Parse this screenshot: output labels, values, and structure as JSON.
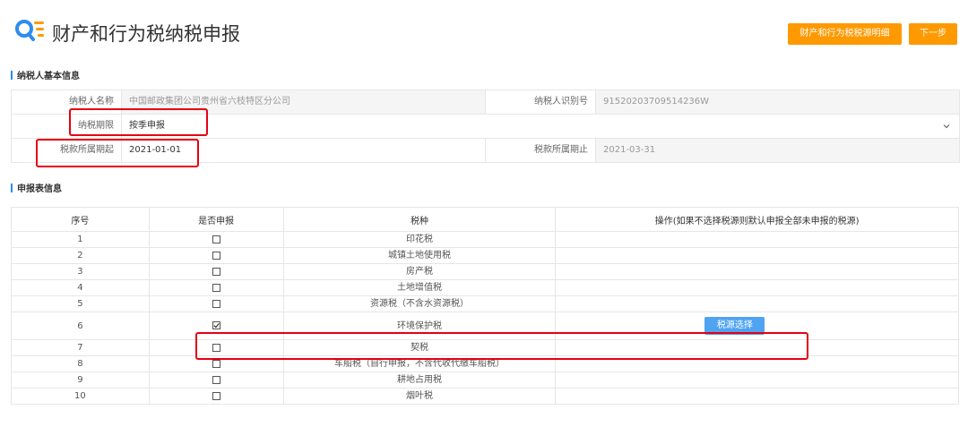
{
  "header": {
    "title": "财产和行为税纳税申报",
    "detail_button": "财产和行为税税源明细",
    "next_button": "下一步"
  },
  "taxpayer_section": {
    "title": "纳税人基本信息",
    "name_label": "纳税人名称",
    "name_value": "中国邮政集团公司贵州省六枝特区分公司",
    "id_label": "纳税人识别号",
    "id_value": "91520203709514236W",
    "period_label": "纳税期限",
    "period_value": "按季申报",
    "start_label": "税款所属期起",
    "start_value": "2021-01-01",
    "end_label": "税款所属期止",
    "end_value": "2021-03-31"
  },
  "report_section": {
    "title": "申报表信息",
    "columns": [
      "序号",
      "是否申报",
      "税种",
      "操作(如果不选择税源则默认申报全部未申报的税源)"
    ],
    "rows": [
      {
        "no": "1",
        "tax": "印花税",
        "checked": false
      },
      {
        "no": "2",
        "tax": "城镇土地使用税",
        "checked": false
      },
      {
        "no": "3",
        "tax": "房产税",
        "checked": false
      },
      {
        "no": "4",
        "tax": "土地增值税",
        "checked": false
      },
      {
        "no": "5",
        "tax": "资源税（不含水资源税）",
        "checked": false
      },
      {
        "no": "6",
        "tax": "环境保护税",
        "checked": true,
        "action": "税源选择"
      },
      {
        "no": "7",
        "tax": "契税",
        "checked": false
      },
      {
        "no": "8",
        "tax": "车船税（自行申报，不含代收代缴车船税）",
        "checked": false
      },
      {
        "no": "9",
        "tax": "耕地占用税",
        "checked": false
      },
      {
        "no": "10",
        "tax": "烟叶税",
        "checked": false
      }
    ]
  },
  "colors": {
    "accent_orange": "#ff9900",
    "accent_blue": "#4fa3f0",
    "highlight_red": "#e60012",
    "section_bar": "#2d8cf0"
  }
}
